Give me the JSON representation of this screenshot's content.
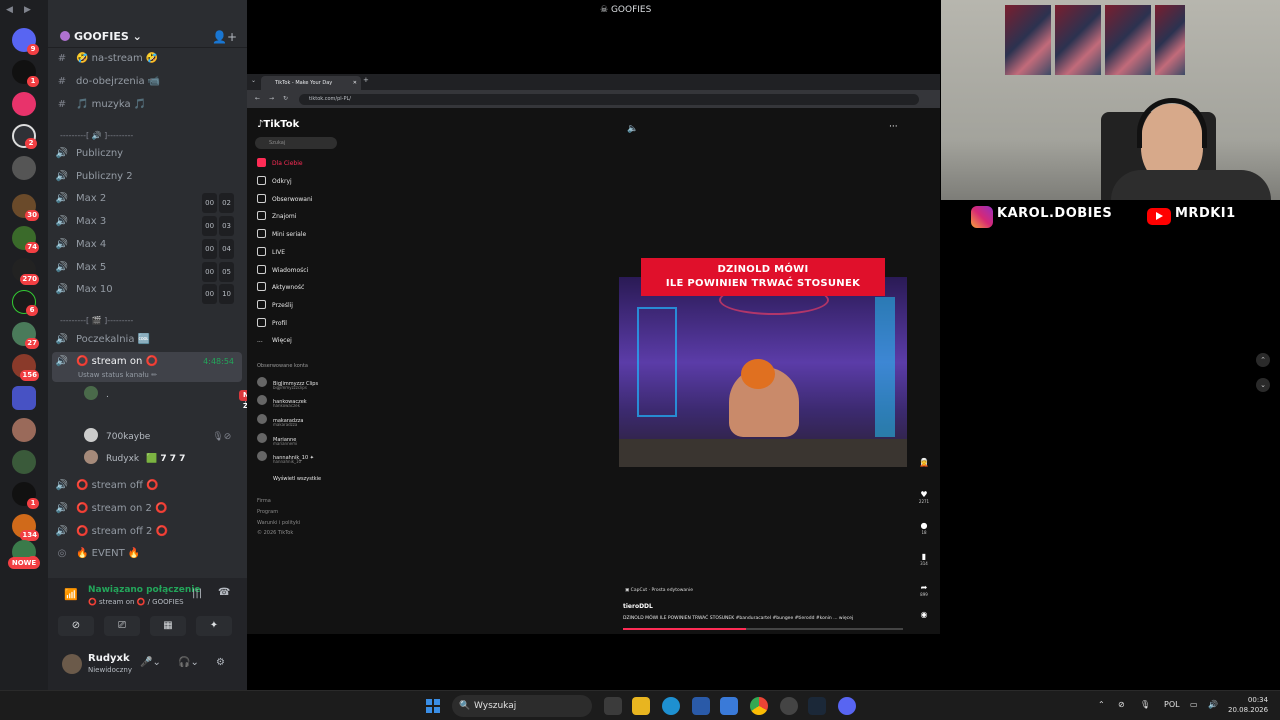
{
  "window": {
    "title": "GOOFIES"
  },
  "discord": {
    "server_name": "GOOFIES",
    "text_channels": [
      {
        "name": "🤣 na-stream 🤣"
      },
      {
        "name": "do-obejrzenia 📹"
      },
      {
        "name": "🎵 muzyka 🎵"
      }
    ],
    "separator_1": "---------[ 🔊 ]---------",
    "voice_channels": [
      {
        "name": "Publiczny",
        "limit": ""
      },
      {
        "name": "Publiczny 2",
        "limit": ""
      },
      {
        "name": "Max 2",
        "count": "00",
        "limit": "02"
      },
      {
        "name": "Max 3",
        "count": "00",
        "limit": "03"
      },
      {
        "name": "Max 4",
        "count": "00",
        "limit": "04"
      },
      {
        "name": "Max 5",
        "count": "00",
        "limit": "05"
      },
      {
        "name": "Max 10",
        "count": "00",
        "limit": "10"
      }
    ],
    "separator_2": "---------[ 🎬 ]---------",
    "waiting_room": "Poczekalnia 🆒",
    "active_channel": {
      "name": "⭕ stream on ⭕",
      "time": "4:48:54",
      "status": "Ustaw status kanału ✏"
    },
    "live_badge": "NA ŻYWO",
    "members": [
      {
        "name": "."
      },
      {
        "name": "700kaybe"
      },
      {
        "name": "Rudyxk",
        "tag": "🟩 7 7 7"
      }
    ],
    "more_channels": [
      {
        "name": "⭕ stream off ⭕"
      },
      {
        "name": "⭕ stream on 2 ⭕"
      },
      {
        "name": "⭕ stream off 2 ⭕"
      },
      {
        "name": "🔥 EVENT 🔥"
      }
    ],
    "voice_status": "Nawiązano połączenie",
    "voice_location": "⭕ stream on ⭕ / GOOFIES",
    "user": {
      "name": "Rudyxk",
      "status": "Niewidoczny"
    },
    "rail_badges": [
      "9",
      "1",
      "2",
      "30",
      "74",
      "270",
      "6",
      "27",
      "156",
      "1",
      "134",
      "1"
    ],
    "new_pill": "NOWE"
  },
  "browser": {
    "tab_title": "TikTok - Make Your Day",
    "url": "tiktok.com/pl-PL/",
    "tiktok": {
      "logo": "TikTok",
      "search_placeholder": "Szukaj",
      "nav": [
        "Dla Ciebie",
        "Odkryj",
        "Obserwowani",
        "Znajomi",
        "Mini seriale",
        "LIVE",
        "Wiadomości",
        "Aktywność",
        "Prześlij",
        "Profil",
        "Więcej"
      ],
      "following_header": "Obserwowane konta",
      "accounts": [
        {
          "name": "BigJimmyzzz Clips",
          "handle": "bigjimmyzzzclips"
        },
        {
          "name": "hankowaczek",
          "handle": "hankowaczek"
        },
        {
          "name": "makaradzza",
          "handle": "makaradzza"
        },
        {
          "name": "Marianne",
          "handle": "mariannemi"
        },
        {
          "name": "hannahnik_10 ✦",
          "handle": "hannahnik_10"
        },
        {
          "name": "Wyświetl wszystkie",
          "handle": ""
        }
      ],
      "footer": [
        "Firma",
        "Program",
        "Warunki i polityki",
        "© 2026 TikTok"
      ],
      "video": {
        "caption_line1": "DZINOLD MÓWI",
        "caption_line2": "ILE POWINIEN TRWAĆ STOSUNEK",
        "capcut": "▣ CapCut · Prosta edytowanie",
        "author": "tieroDDL",
        "description": "DZINOLD MÓWI ILE POWINIEN TRWAĆ STOSUNEK #banduracartel #bungee #tierodd #konin ...   więcej",
        "progress": 0.44,
        "actions": [
          {
            "icon": "heart-icon",
            "count": "2271"
          },
          {
            "icon": "comment-icon",
            "count": "18"
          },
          {
            "icon": "bookmark-icon",
            "count": "314"
          },
          {
            "icon": "share-icon",
            "count": "899"
          }
        ]
      }
    }
  },
  "socials": {
    "instagram": "KAROL.DOBIES",
    "youtube": "MRDKI1"
  },
  "taskbar": {
    "search": "Wyszukaj",
    "lang": "POL",
    "time": "00:34",
    "date": "20.08.2026"
  }
}
